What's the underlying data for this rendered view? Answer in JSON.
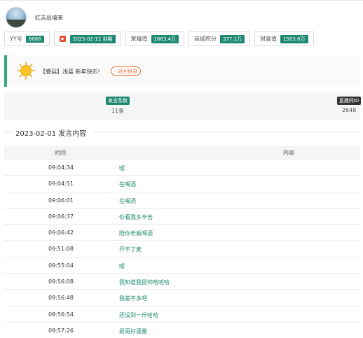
{
  "profile": {
    "username": "红吉出墙来"
  },
  "badges": [
    {
      "label": "YY号",
      "value": "6668"
    },
    {
      "label": "",
      "value": "2025-02-12 到期"
    },
    {
      "label": "荣耀值",
      "value": "1663.4万"
    },
    {
      "label": "商城积分",
      "value": "377.1万"
    },
    {
      "label": "财富值",
      "value": "1503.6万"
    }
  ],
  "notice": {
    "text": "【睿廷】浅蓝 新年快乐!",
    "back_label": "返回目录"
  },
  "stats": {
    "count_label": "发言条数",
    "count_value": "11条",
    "room_label": "直播间ID",
    "room_value": "2648"
  },
  "section": {
    "title": "2023-02-01 发言内容"
  },
  "table": {
    "columns": [
      "时间",
      "内容"
    ],
    "rows": [
      {
        "time": "09:04:34",
        "content": "嘘"
      },
      {
        "time": "09:04:51",
        "content": "在喝酒"
      },
      {
        "time": "09:06:01",
        "content": "在喝酒"
      },
      {
        "time": "09:06:37",
        "content": "你看我多辛苦"
      },
      {
        "time": "09:06:42",
        "content": "陪你老板喝酒"
      },
      {
        "time": "09:51:08",
        "content": "开不了麦"
      },
      {
        "time": "09:55:04",
        "content": "嘘"
      },
      {
        "time": "09:56:08",
        "content": "我知道我挺帅哈哈哈"
      },
      {
        "time": "09:56:48",
        "content": "我差不多吧"
      },
      {
        "time": "09:56:54",
        "content": "还没到一斤哈哈"
      },
      {
        "time": "09:57:26",
        "content": "挺哥好酒量"
      }
    ]
  },
  "colors": {
    "accent": "#1f8a70",
    "warning": "#e9703a"
  }
}
